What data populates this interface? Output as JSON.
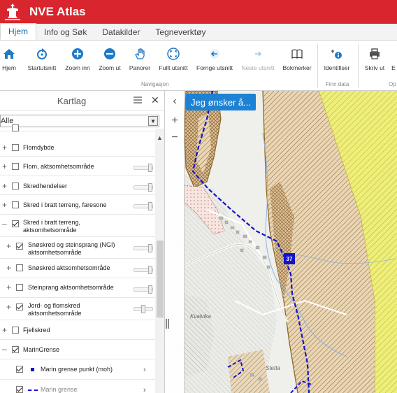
{
  "app": {
    "title": "NVE Atlas"
  },
  "tabs": [
    {
      "label": "Hjem",
      "active": true
    },
    {
      "label": "Info og Søk",
      "active": false
    },
    {
      "label": "Datakilder",
      "active": false
    },
    {
      "label": "Tegneverktøy",
      "active": false
    }
  ],
  "ribbon": {
    "buttons": [
      {
        "label": "Hjem",
        "icon": "home-icon",
        "enabled": true
      },
      {
        "label": "Startutsnitt",
        "icon": "refresh-icon",
        "enabled": true
      },
      {
        "label": "Zoom inn",
        "icon": "zoom-in-icon",
        "enabled": true
      },
      {
        "label": "Zoom ut",
        "icon": "zoom-out-icon",
        "enabled": true
      },
      {
        "label": "Panorer",
        "icon": "hand-icon",
        "enabled": true
      },
      {
        "label": "Fullt utsnitt",
        "icon": "fullscreen-icon",
        "enabled": true
      },
      {
        "label": "Forrige utsnitt",
        "icon": "back-arrow-icon",
        "enabled": true
      },
      {
        "label": "Neste utsnitt",
        "icon": "forward-arrow-icon",
        "enabled": false
      },
      {
        "label": "Bokmerker",
        "icon": "book-icon",
        "enabled": true
      },
      {
        "label": "Identifiser",
        "icon": "identify-icon",
        "enabled": true
      },
      {
        "label": "Skriv ut",
        "icon": "print-icon",
        "enabled": true
      },
      {
        "label": "E",
        "icon": "export-icon",
        "enabled": true
      }
    ],
    "groups": {
      "navigation": "Navigasjon",
      "find": "Finn data",
      "other": "Op"
    }
  },
  "panel": {
    "title": "Kartlag",
    "filter_value": "Alle",
    "layers": [
      {
        "label": "Flomdybde",
        "checked": false,
        "expandable": true,
        "slider": false
      },
      {
        "label": "Flom, aktsomhetsområde",
        "checked": false,
        "expandable": true,
        "slider": true
      },
      {
        "label": "Skredhendelser",
        "checked": false,
        "expandable": true,
        "slider": true
      },
      {
        "label": "Skred i bratt terreng, faresone",
        "checked": false,
        "expandable": true,
        "slider": true
      },
      {
        "label": "Skred i bratt terreng, aktsomhetsområde",
        "checked": true,
        "expandable": true,
        "expanded": true,
        "slider": false
      },
      {
        "label": "Snøskred og steinsprang (NGI) aktsomhetsområde",
        "checked": true,
        "expandable": true,
        "slider": true
      },
      {
        "label": "Snøskred aktsomhetsområde",
        "checked": false,
        "expandable": true,
        "slider": true
      },
      {
        "label": "Steinprang aktsomhetsområde",
        "checked": false,
        "expandable": true,
        "slider": true
      },
      {
        "label": "Jord- og flomskred aktsomhetsområde",
        "checked": true,
        "expandable": true,
        "slider": true
      },
      {
        "label": "Fjellskred",
        "checked": false,
        "expandable": true,
        "slider": false
      },
      {
        "label": "MarinGrense",
        "checked": true,
        "expandable": true,
        "expanded": true,
        "slider": false
      },
      {
        "label": "Marin grense punkt (moh)",
        "checked": true,
        "expandable": false,
        "legend": "square"
      },
      {
        "label": "Marin grense",
        "checked": true,
        "expandable": false,
        "legend": "dashed"
      }
    ]
  },
  "map": {
    "wish_button": "Jeg ønsker å...",
    "badge": "37",
    "places": {
      "kvalvika": "Kvalvika",
      "stetta": "Stetta"
    }
  },
  "colors": {
    "brand_red": "#d9262e",
    "accent_blue": "#1d82d3",
    "marine_limit": "#1313c9",
    "hazard_brown": "#a07845",
    "hazard_yellow": "#e8e84a"
  }
}
